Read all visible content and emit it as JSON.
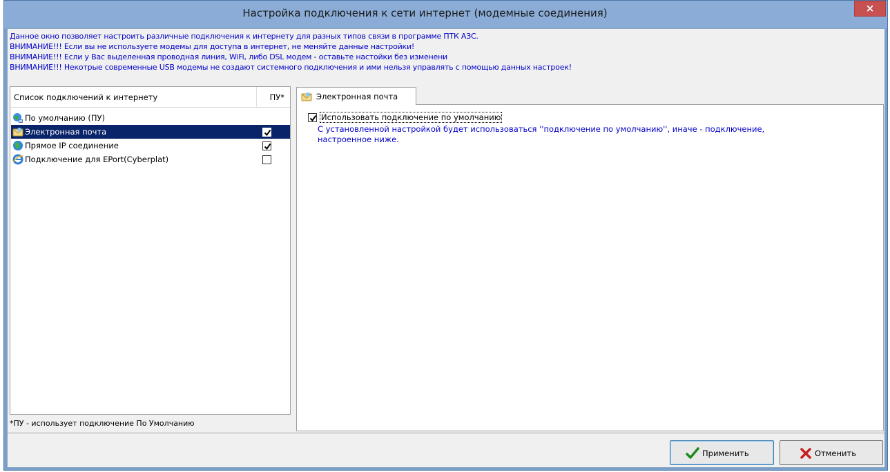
{
  "window": {
    "title": "Настройка подключения к сети интернет (модемные соединения)",
    "close_label": "×"
  },
  "info_lines": [
    "Данное окно позволяет настроить различные подключения к интернету для разных типов связи в программе ПТК АЗС.",
    "ВНИМАНИЕ!!! Если вы не используете модемы для доступа в интернет, не меняйте данные настройки!",
    "ВНИМАНИЕ!!! Если у Вас выделенная проводная линия, WiFi, либо DSL модем - оставьте настойки без изменени",
    "ВНИМАНИЕ!!! Некотрые современные USB модемы не создают системного подключения и ими нельзя управлять с помощью данных настроек!"
  ],
  "connections": {
    "header_name": "Список подключений к интернету",
    "header_pu": "ПУ*",
    "items": [
      {
        "label": "По умолчанию (ПУ)",
        "icon": "globe-network-icon",
        "has_checkbox": false,
        "checked": false,
        "selected": false
      },
      {
        "label": "Электронная почта",
        "icon": "email-envelope-icon",
        "has_checkbox": true,
        "checked": true,
        "selected": true
      },
      {
        "label": "Прямое IP соединение",
        "icon": "globe-icon",
        "has_checkbox": true,
        "checked": true,
        "selected": false
      },
      {
        "label": "Подключение для EPort(Cyberplat)",
        "icon": "internet-explorer-icon",
        "has_checkbox": true,
        "checked": false,
        "selected": false
      }
    ]
  },
  "footnote": "*ПУ - использует подключение По Умолчанию",
  "tab": {
    "label": "Электронная почта",
    "icon": "email-envelope-icon"
  },
  "settings": {
    "use_default_label": "Использовать подключение по умолчанию",
    "use_default_checked": true,
    "description_line1": "С установленной настройкой будет использоваться ''подключение по умолчанию'', иначе - подключение,",
    "description_line2": "настроенное ниже."
  },
  "buttons": {
    "apply_label": "Применить",
    "cancel_label": "Отменить"
  },
  "colors": {
    "info_text": "#0000c8",
    "selection": "#0a246a",
    "close_button": "#c75050"
  }
}
